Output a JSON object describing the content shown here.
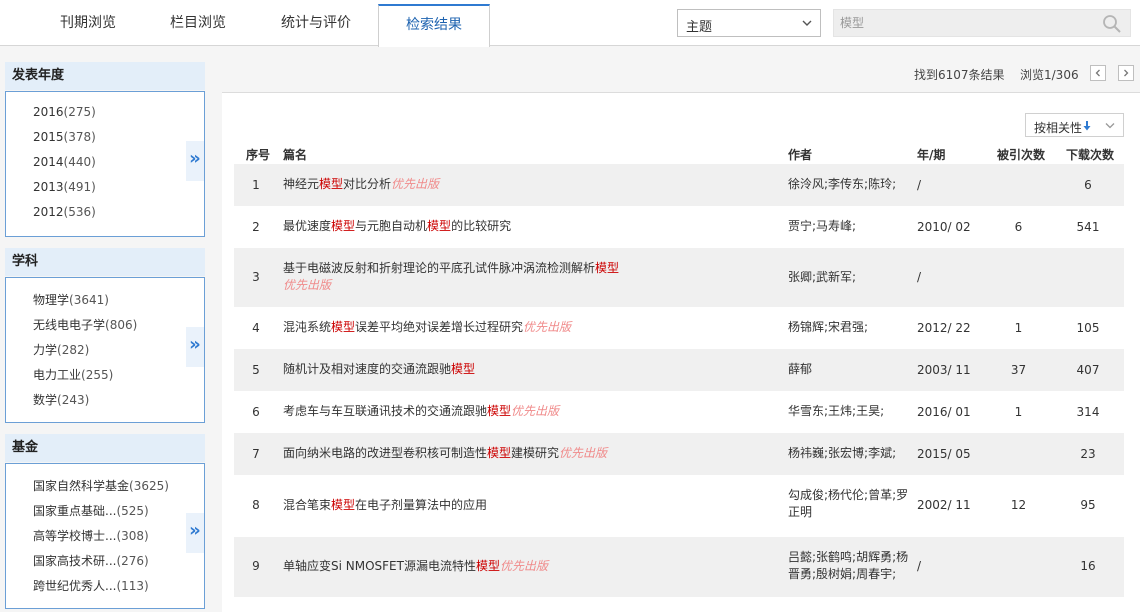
{
  "tabs": [
    {
      "label": "刊期浏览"
    },
    {
      "label": "栏目浏览"
    },
    {
      "label": "统计与评价"
    },
    {
      "label": "检索结果"
    }
  ],
  "search": {
    "field": "主题",
    "placeholder": "模型"
  },
  "facets": {
    "year": {
      "title": "发表年度",
      "items": [
        {
          "name": "2016",
          "count": "(275)"
        },
        {
          "name": "2015",
          "count": "(378)"
        },
        {
          "name": "2014",
          "count": "(440)"
        },
        {
          "name": "2013",
          "count": "(491)"
        },
        {
          "name": "2012",
          "count": "(536)"
        }
      ]
    },
    "subject": {
      "title": "学科",
      "items": [
        {
          "name": "物理学",
          "count": "(3641)"
        },
        {
          "name": "无线电电子学",
          "count": "(806)"
        },
        {
          "name": "力学",
          "count": "(282)"
        },
        {
          "name": "电力工业",
          "count": "(255)"
        },
        {
          "name": "数学",
          "count": "(243)"
        }
      ]
    },
    "fund": {
      "title": "基金",
      "items": [
        {
          "name": "国家自然科学基金",
          "count": "(3625)"
        },
        {
          "name": "国家重点基础...",
          "count": "(525)"
        },
        {
          "name": "高等学校博士...",
          "count": "(308)"
        },
        {
          "name": "国家高技术研...",
          "count": "(276)"
        },
        {
          "name": "跨世纪优秀人...",
          "count": "(113)"
        }
      ]
    },
    "more_symbol": "»"
  },
  "results_info": {
    "found": "找到6107条结果",
    "browse": "浏览1/306"
  },
  "sort": {
    "label": "按相关性"
  },
  "table": {
    "headers": {
      "idx": "序号",
      "title": "篇名",
      "author": "作者",
      "year": "年/期",
      "cite": "被引次数",
      "download": "下载次数"
    },
    "rows": [
      {
        "idx": "1",
        "t1": "神经元",
        "kw1": "模型",
        "t2": "对比分析",
        "kw2": "",
        "t3": "",
        "priority": "优先出版",
        "author": "徐泠风;李传东;陈玲;",
        "year": "/",
        "cite": "",
        "download": "6"
      },
      {
        "idx": "2",
        "t1": "最优速度",
        "kw1": "模型",
        "t2": "与元胞自动机",
        "kw2": "模型",
        "t3": "的比较研究",
        "priority": "",
        "author": "贾宁;马寿峰;",
        "year": "2010/ 02",
        "cite": "6",
        "download": "541"
      },
      {
        "idx": "3",
        "t1": "基于电磁波反射和折射理论的平底孔试件脉冲涡流检测解析",
        "kw1": "模型",
        "t2": "",
        "kw2": "",
        "t3": "",
        "priority": "优先出版",
        "author": "张卿;武新军;",
        "year": "/",
        "cite": "",
        "download": ""
      },
      {
        "idx": "4",
        "t1": "混沌系统",
        "kw1": "模型",
        "t2": "误差平均绝对误差增长过程研究",
        "kw2": "",
        "t3": "",
        "priority": "优先出版",
        "author": "杨锦辉;宋君强;",
        "year": "2012/ 22",
        "cite": "1",
        "download": "105"
      },
      {
        "idx": "5",
        "t1": "随机计及相对速度的交通流跟驰",
        "kw1": "模型",
        "t2": "",
        "kw2": "",
        "t3": "",
        "priority": "",
        "author": "薛郁",
        "year": "2003/ 11",
        "cite": "37",
        "download": "407"
      },
      {
        "idx": "6",
        "t1": "考虑车与车互联通讯技术的交通流跟驰",
        "kw1": "模型",
        "t2": "",
        "kw2": "",
        "t3": "",
        "priority": "优先出版",
        "author": "华雪东;王炜;王昊;",
        "year": "2016/ 01",
        "cite": "1",
        "download": "314"
      },
      {
        "idx": "7",
        "t1": "面向纳米电路的改进型卷积核可制造性",
        "kw1": "模型",
        "t2": "建模研究",
        "kw2": "",
        "t3": "",
        "priority": "优先出版",
        "author": "杨祎巍;张宏博;李斌;",
        "year": "2015/ 05",
        "cite": "",
        "download": "23"
      },
      {
        "idx": "8",
        "t1": "混合笔束",
        "kw1": "模型",
        "t2": "在电子剂量算法中的应用",
        "kw2": "",
        "t3": "",
        "priority": "",
        "author": "勾成俊;杨代伦;曾革;罗正明",
        "year": "2002/ 11",
        "cite": "12",
        "download": "95"
      },
      {
        "idx": "9",
        "t1": "单轴应变Si NMOSFET源漏电流特性",
        "kw1": "模型",
        "t2": "",
        "kw2": "",
        "t3": "",
        "priority": "优先出版",
        "author": "吕懿;张鹤鸣;胡辉勇;杨晋勇;殷树娟;周春宇;",
        "year": "/",
        "cite": "",
        "download": "16"
      }
    ]
  },
  "colors": {
    "accent": "#2f7ad1",
    "keyword": "#cc0000",
    "priority": "#f08a8a",
    "facet_header": "#e3eef9"
  }
}
